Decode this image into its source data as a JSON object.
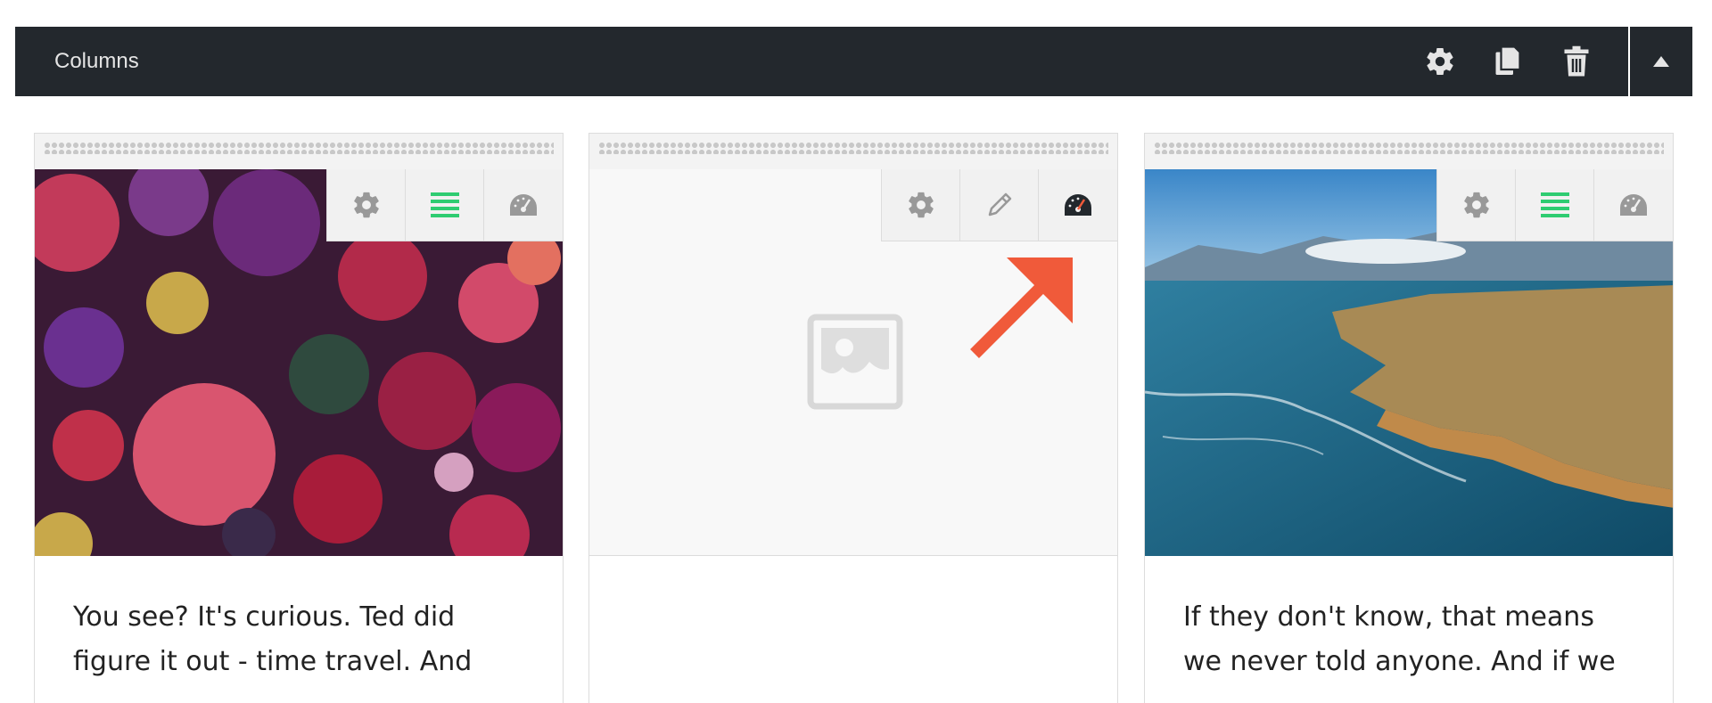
{
  "header": {
    "title": "Columns",
    "actions": [
      {
        "name": "settings-button",
        "icon": "gear-icon"
      },
      {
        "name": "duplicate-button",
        "icon": "copy-icon"
      },
      {
        "name": "delete-button",
        "icon": "trash-icon"
      }
    ],
    "collapse_icon": "caret-up-icon"
  },
  "columns": [
    {
      "media": "flowers-image",
      "toolbar": [
        "gear-icon",
        "rows-icon",
        "gauge-icon"
      ],
      "text": "You see? It's curious. Ted did\nfigure it out - time travel. And"
    },
    {
      "media": "image-placeholder-icon",
      "toolbar": [
        "gear-icon",
        "pencil-icon",
        "gauge-icon"
      ],
      "text": ""
    },
    {
      "media": "coastline-image",
      "toolbar": [
        "gear-icon",
        "rows-icon",
        "gauge-icon"
      ],
      "text": "If they don't know, that means\nwe never told anyone. And if we"
    }
  ],
  "colors": {
    "header_bg": "#23282d",
    "active_green": "#2ecc71",
    "callout_arrow": "#f05a3a"
  }
}
